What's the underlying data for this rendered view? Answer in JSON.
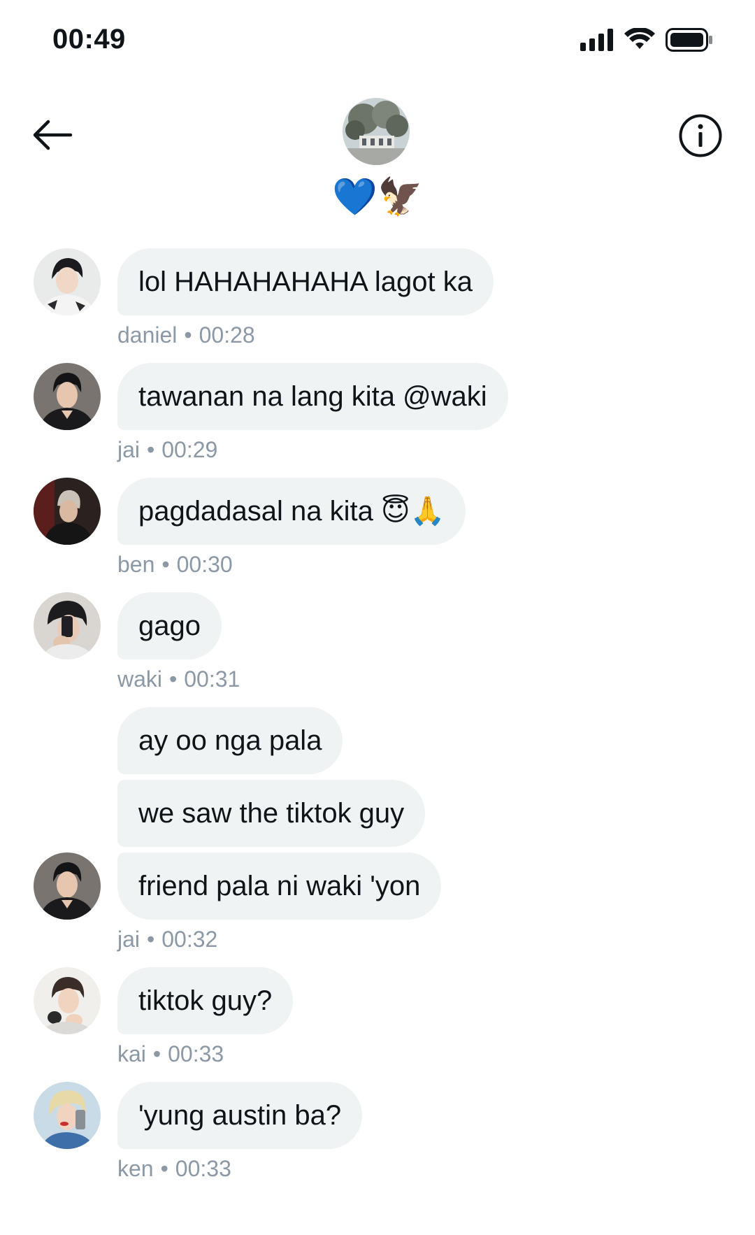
{
  "status_bar": {
    "time": "00:49",
    "icons": [
      "cellular-signal-icon",
      "wifi-icon",
      "battery-icon"
    ]
  },
  "header": {
    "back_icon": "arrow-left-icon",
    "info_icon": "info-icon",
    "group_name": "💙🦅"
  },
  "messages": [
    {
      "sender": "daniel",
      "time": "00:28",
      "bubbles": [
        "lol HAHAHAHAHA lagot ka"
      ]
    },
    {
      "sender": "jai",
      "time": "00:29",
      "bubbles": [
        "tawanan na lang kita @waki"
      ]
    },
    {
      "sender": "ben",
      "time": "00:30",
      "bubbles": [
        "pagdadasal na kita 😇🙏"
      ]
    },
    {
      "sender": "waki",
      "time": "00:31",
      "bubbles": [
        "gago"
      ]
    },
    {
      "sender": "jai",
      "time": "00:32",
      "bubbles": [
        "ay oo nga pala",
        "we saw the tiktok guy",
        "friend pala ni waki 'yon"
      ]
    },
    {
      "sender": "kai",
      "time": "00:33",
      "bubbles": [
        "tiktok guy?"
      ]
    },
    {
      "sender": "ken",
      "time": "00:33",
      "bubbles": [
        "'yung austin ba?"
      ]
    }
  ],
  "meta_separator": "•",
  "colors": {
    "bubble_bg": "#eff3f4",
    "meta_text": "#8b98a5",
    "text": "#0f1419",
    "emoji_blue_heart": "#2f8cf5"
  }
}
